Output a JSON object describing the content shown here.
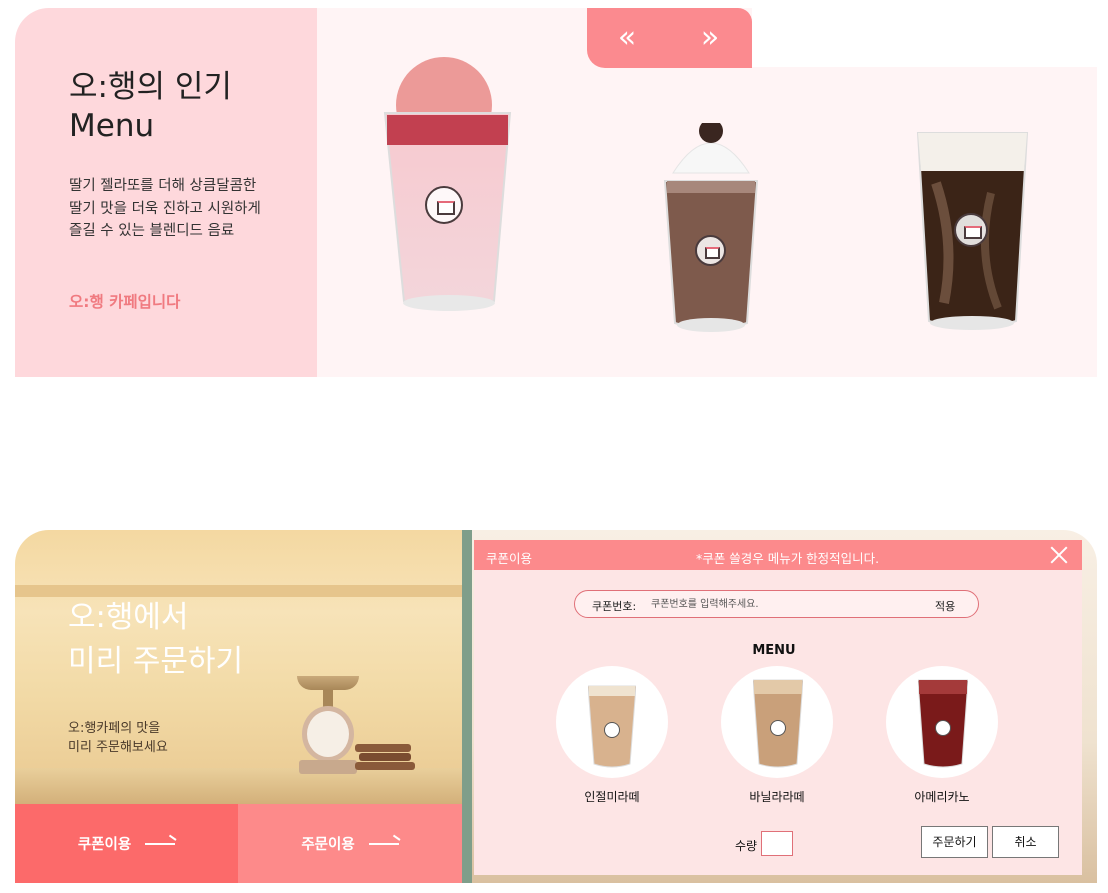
{
  "top": {
    "title_line1": "오:행의 인기",
    "title_line2": "Menu",
    "desc_line1": "딸기 젤라또를 더해 상큼달콤한",
    "desc_line2": "딸기 맛을 더욱 진하고 시원하게",
    "desc_line3": "즐길 수 있는 블렌디드 음료",
    "cafe_label": "오:행 카페입니다",
    "prev_arrow": "«",
    "next_arrow": "»",
    "drinks": [
      "strawberry-gelato-blended",
      "chocolate-whipped-frappe",
      "cream-cold-brew"
    ]
  },
  "bottom": {
    "title_line1": "오:행에서",
    "title_line2": "미리 주문하기",
    "desc_line1": "오:행카페의 맛을",
    "desc_line2": "미리 주문해보세요",
    "coupon_button": "쿠폰이용",
    "order_button": "주문이용"
  },
  "modal": {
    "title": "쿠폰이용",
    "notice": "*쿠폰 쓸경우 메뉴가 한정적입니다.",
    "coupon_label": "쿠폰번호:",
    "coupon_placeholder": "쿠폰번호를 입력해주세요.",
    "apply_label": "적용",
    "menu_title": "MENU",
    "menu_items": [
      {
        "name": "인절미라떼",
        "color": "#d8b28e"
      },
      {
        "name": "바닐라라떼",
        "color": "#c9a07a"
      },
      {
        "name": "아메리카노",
        "color": "#7a1a1a"
      }
    ],
    "qty_label": "수량",
    "submit_label": "주문하기",
    "cancel_label": "취소"
  },
  "colors": {
    "accent_pink": "#fc8a8c",
    "coral": "#fc6a6a",
    "soft_pink": "#fed8dc"
  }
}
